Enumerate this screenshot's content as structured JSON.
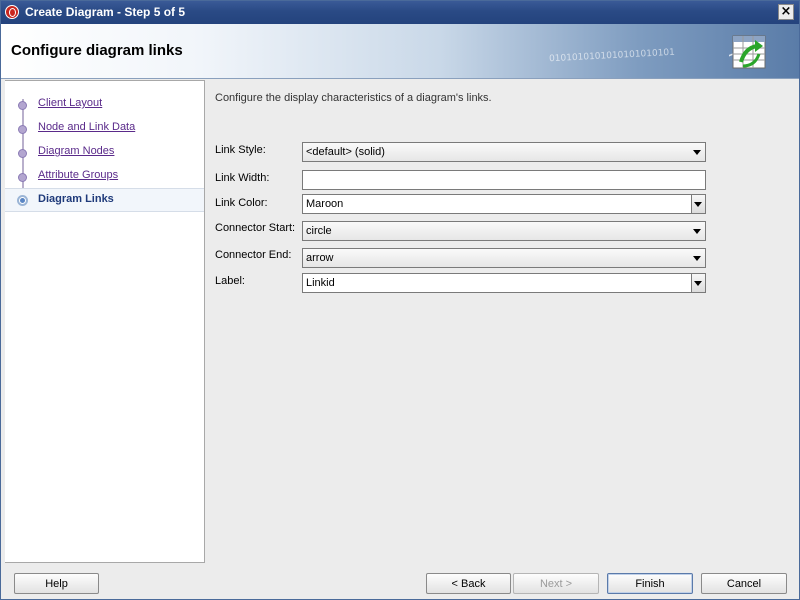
{
  "window": {
    "title": "Create Diagram -  Step 5 of 5",
    "close_glyph": "×"
  },
  "header": {
    "heading": "Configure diagram links",
    "binary_text": "0101010101010101010101",
    "icon": "diagram-table-icon"
  },
  "nav": {
    "items": [
      {
        "label": "Client Layout",
        "active": false
      },
      {
        "label": "Node and Link Data",
        "active": false
      },
      {
        "label": "Diagram Nodes",
        "active": false
      },
      {
        "label": "Attribute Groups",
        "active": false
      },
      {
        "label": "Diagram Links",
        "active": true
      }
    ]
  },
  "content": {
    "description": "Configure the display characteristics of a diagram's links.",
    "fields": {
      "link_style": {
        "label": "Link Style:",
        "value": "<default> (solid)"
      },
      "link_width": {
        "label": "Link Width:",
        "value": ""
      },
      "link_color": {
        "label": "Link Color:",
        "value": "Maroon"
      },
      "connector_start": {
        "label": "Connector Start:",
        "value": "circle"
      },
      "connector_end": {
        "label": "Connector End:",
        "value": "arrow"
      },
      "label": {
        "label": "Label:",
        "value": "Linkid"
      }
    }
  },
  "buttons": {
    "help": "Help",
    "back": "< Back",
    "next": "Next >",
    "finish": "Finish",
    "cancel": "Cancel"
  }
}
